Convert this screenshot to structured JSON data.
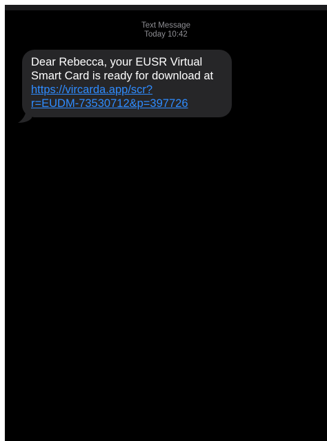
{
  "header": {
    "type_label": "Text Message",
    "timestamp": "Today 10:42"
  },
  "message": {
    "text": "Dear Rebecca, your EUSR Virtual Smart Card is ready for download at",
    "link_line_1": "https://vircarda.app/scr?",
    "link_line_2": "r=EUDM-73530712&p=397726"
  },
  "colors": {
    "background": "#000000",
    "bubble": "#262628",
    "link": "#2f8cff",
    "meta_text": "#8e8e93"
  }
}
